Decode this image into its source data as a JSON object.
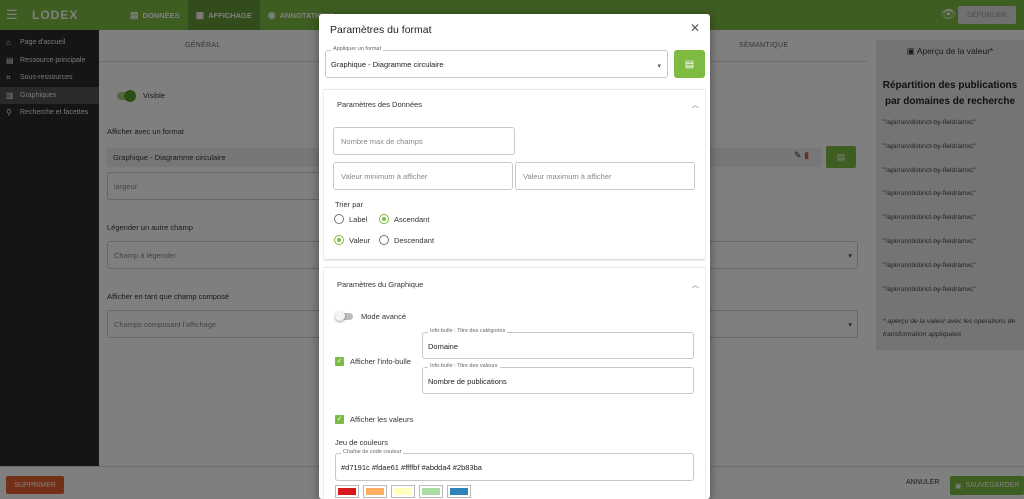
{
  "topbar": {
    "brand": "LODEX",
    "tabs": [
      {
        "label": "DONNÉES",
        "icon": "list-icon"
      },
      {
        "label": "AFFICHAGE",
        "icon": "image-icon"
      },
      {
        "label": "ANNOTATIONS",
        "icon": "chat-icon"
      }
    ],
    "publish_label": "DÉPUBLIER"
  },
  "sidebar": {
    "items": [
      {
        "label": "Page d'accueil",
        "icon": "home-icon"
      },
      {
        "label": "Ressource principale",
        "icon": "document-icon"
      },
      {
        "label": "Sous-ressources",
        "icon": "grid-icon"
      },
      {
        "label": "Graphiques",
        "icon": "bar-chart-icon"
      },
      {
        "label": "Recherche et facettes",
        "icon": "search-people-icon"
      }
    ]
  },
  "main": {
    "subtabs": [
      "GÉNÉRAL",
      "SÉMANTIQUE"
    ],
    "visible_label": "Visible",
    "format_section_label": "Afficher avec un format",
    "format_value": "Graphique - Diagramme circulaire",
    "width_placeholder": "largeur",
    "legend_section_label": "Légender un autre champ",
    "legend_placeholder": "Champ à légender",
    "composed_section_label": "Afficher en tant que champ composé",
    "composed_placeholder": "Champs composant l'affichage"
  },
  "preview": {
    "title": "Aperçu de la valeur*",
    "heading": "Répartition des publications par domaines de recherche",
    "rows": [
      "\"/api/run/distinct-by-field/amxc\"",
      "\"/api/run/distinct-by-field/amxc\"",
      "\"/api/run/distinct-by-field/amxc\"",
      "\"/api/run/distinct-by-field/amxc\"",
      "\"/api/run/distinct-by-field/amxc\"",
      "\"/api/run/distinct-by-field/amxc\"",
      "\"/api/run/distinct-by-field/amxc\"",
      "\"/api/run/distinct-by-field/amxc\""
    ],
    "footnote": "* aperçu de la valeur avec les opérations de transformation appliquées"
  },
  "bottombar": {
    "delete_label": "SUPPRIMER",
    "cancel_label": "ANNULER",
    "save_label": "SAUVEGARDER"
  },
  "modal": {
    "title": "Paramètres du format",
    "apply_format_legend": "Appliquer un format",
    "apply_format_value": "Graphique - Diagramme circulaire",
    "data_panel": {
      "title": "Paramètres des Données",
      "max_fields_placeholder": "Nombre max de champs",
      "min_value_placeholder": "Valeur minimum à afficher",
      "max_value_placeholder": "Valeur maximum à afficher",
      "sort_label": "Trier par",
      "sort_options": [
        "Label",
        "Valeur"
      ],
      "order_options": [
        "Ascendant",
        "Descendant"
      ],
      "sort_selected": "Valeur",
      "order_selected": "Ascendant"
    },
    "chart_panel": {
      "title": "Paramètres du Graphique",
      "advanced_mode_label": "Mode avancé",
      "tooltip_checkbox_label": "Afficher l'info-bulle",
      "tooltip_category_legend": "Info-bulle : Titre des catégories",
      "tooltip_category_value": "Domaine",
      "tooltip_value_legend": "Info-bulle : Titre des valeurs",
      "tooltip_value_value": "Nombre de publications",
      "show_values_label": "Afficher les valeurs",
      "color_set_label": "Jeu de couleurs",
      "color_string_legend": "Chaîne de code couleur",
      "color_string_value": "#d7191c #fdae61 #ffffbf #abdda4 #2b83ba",
      "colors": [
        "#d7191c",
        "#fdae61",
        "#ffffbf",
        "#abdda4",
        "#2b83ba"
      ]
    }
  },
  "colors": {
    "accent": "#7dbb42",
    "danger": "#e8612f",
    "sidebar": "#2b2b2b"
  }
}
